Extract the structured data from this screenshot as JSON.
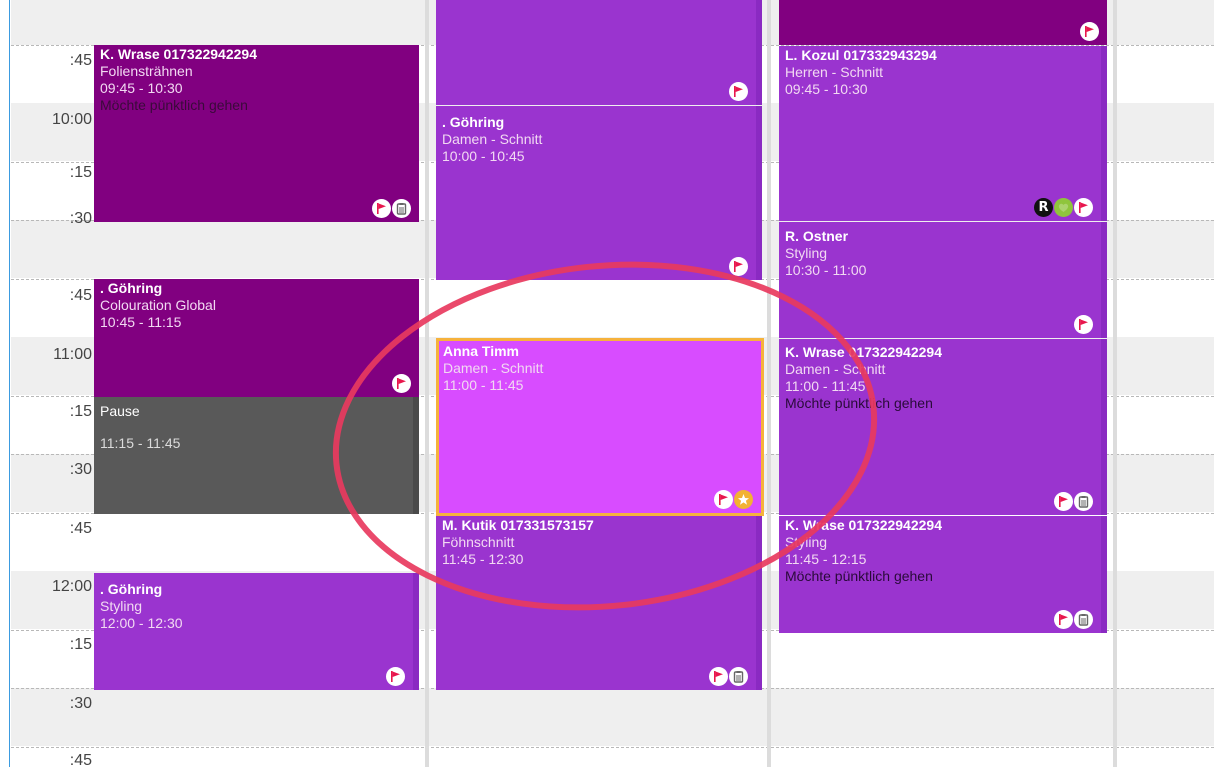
{
  "time_labels": [
    ":45",
    "10:00",
    ":15",
    ":30",
    ":45",
    "11:00",
    ":15",
    ":30",
    ":45",
    "12:00",
    ":15",
    ":30",
    ":45"
  ],
  "appointments": {
    "col1": [
      {
        "name": "K. Wrase 017322942294",
        "service": "Foliensträhnen",
        "time": "09:45 - 10:30",
        "note": "Möchte pünktlich gehen"
      },
      {
        "name": ". Göhring",
        "service": "Colouration Global",
        "time": "10:45 - 11:15"
      },
      {
        "name": "Pause",
        "time": "11:15 - 11:45"
      },
      {
        "name": ". Göhring",
        "service": "Styling",
        "time": "12:00 - 12:30"
      }
    ],
    "col2": [
      {
        "name": ". Göhring",
        "service": "Damen - Schnitt",
        "time": "10:00 - 10:45"
      },
      {
        "name": "Anna Timm",
        "service": "Damen - Schnitt",
        "time": "11:00 - 11:45"
      },
      {
        "name": "M. Kutik 017331573157",
        "service": "Föhnschnitt",
        "time": "11:45 - 12:30"
      }
    ],
    "col3": [
      {
        "name": "L. Kozul 017332943294",
        "service": "Herren - Schnitt",
        "time": "09:45 - 10:30"
      },
      {
        "name": "R. Ostner",
        "service": "Styling",
        "time": "10:30 - 11:00"
      },
      {
        "name": "K. Wrase 017322942294",
        "service": "Damen - Schnitt",
        "time": "11:00 - 11:45",
        "note": "Möchte pünktlich gehen"
      },
      {
        "name": "K. Wrase 017322942294",
        "service": "Styling",
        "time": "11:45 - 12:15",
        "note": "Möchte pünktlich gehen"
      }
    ]
  },
  "icon_letters": {
    "r": "R"
  },
  "colors": {
    "dark_purple": "#810080",
    "purple": "#9a34cf",
    "selected_pink": "#d84cff",
    "selected_border": "#f6b23c",
    "pause_gray": "#595959",
    "flag_red": "#e8174d",
    "annotation_circle": "#e8395e"
  },
  "icons": [
    "flag-icon",
    "clipboard-icon",
    "star-icon",
    "r-badge-icon",
    "heart-icon"
  ]
}
